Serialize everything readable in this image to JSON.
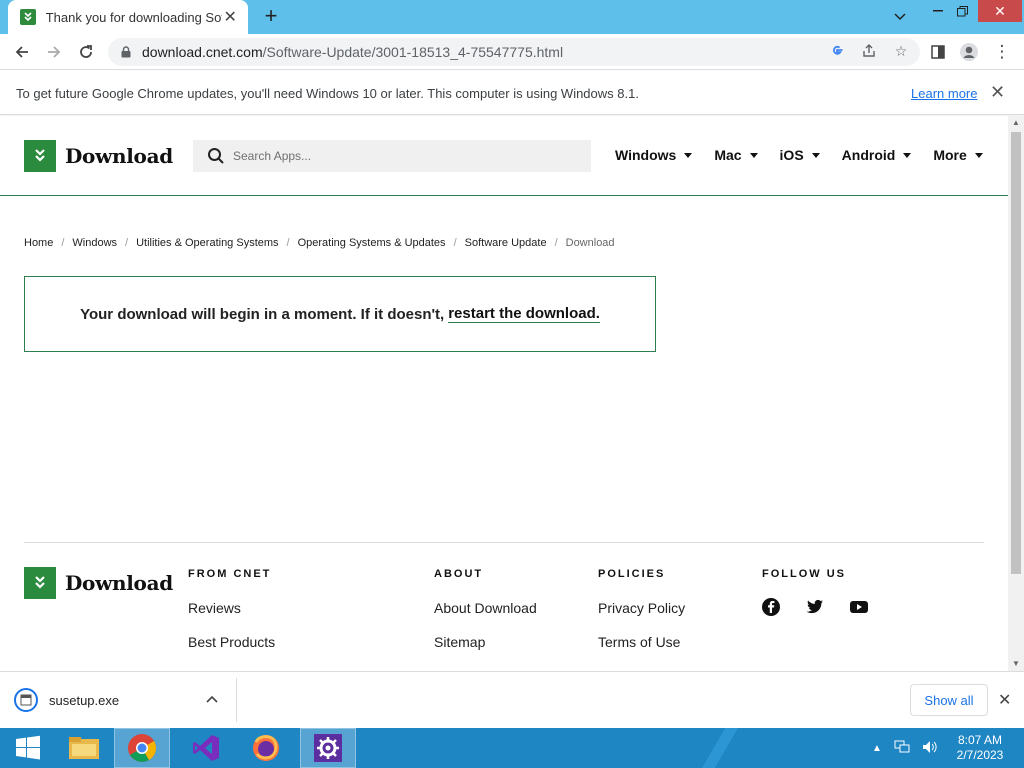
{
  "browser": {
    "tab_title": "Thank you for downloading Softw",
    "new_tab_label": "+",
    "url_host": "download.cnet.com",
    "url_path": "/Software-Update/3001-18513_4-75547775.html"
  },
  "infobar": {
    "message": "To get future Google Chrome updates, you'll need Windows 10 or later. This computer is using Windows 8.1.",
    "link": "Learn more"
  },
  "site": {
    "brand": "Download",
    "search_placeholder": "Search Apps...",
    "nav": [
      "Windows",
      "Mac",
      "iOS",
      "Android",
      "More"
    ],
    "breadcrumb": [
      "Home",
      "Windows",
      "Utilities & Operating Systems",
      "Operating Systems & Updates",
      "Software Update",
      "Download"
    ],
    "notice_text": "Your download will begin in a moment. If it doesn't,",
    "notice_link": "restart the download."
  },
  "footer": {
    "brand": "Download",
    "columns": [
      {
        "heading": "FROM CNET",
        "links": [
          "Reviews",
          "Best Products"
        ]
      },
      {
        "heading": "ABOUT",
        "links": [
          "About Download",
          "Sitemap"
        ]
      },
      {
        "heading": "POLICIES",
        "links": [
          "Privacy Policy",
          "Terms of Use"
        ]
      },
      {
        "heading": "FOLLOW US",
        "links": []
      }
    ],
    "social": [
      "facebook-icon",
      "twitter-icon",
      "youtube-icon"
    ]
  },
  "downloads": {
    "file": "susetup.exe",
    "show_all": "Show all"
  },
  "taskbar": {
    "time": "8:07 AM",
    "date": "2/7/2023"
  },
  "colors": {
    "brand_green": "#2a8a3e",
    "taskbar_blue": "#1f86c4",
    "tabstrip_blue": "#5ec0ea",
    "link_blue": "#1a73e8"
  }
}
